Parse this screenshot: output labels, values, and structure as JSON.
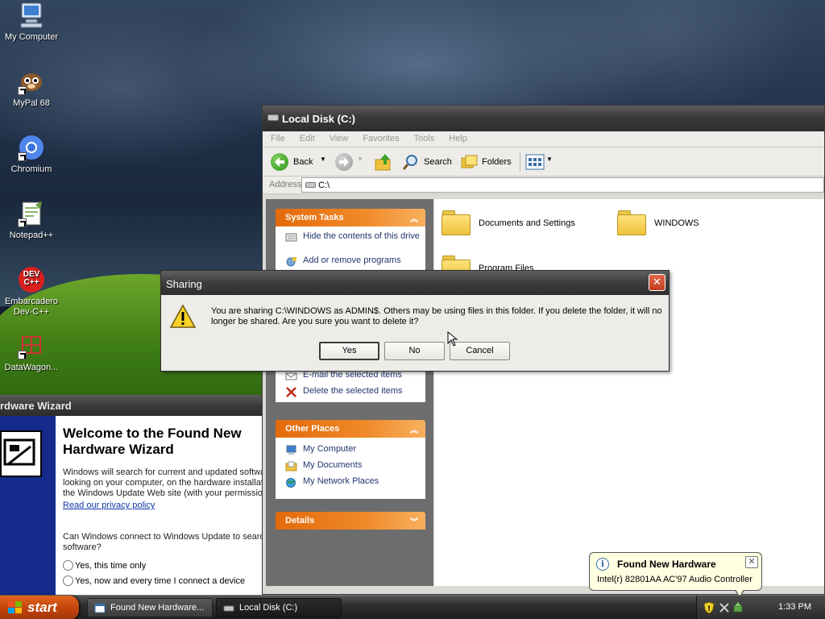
{
  "desktop": {
    "icons": [
      {
        "label": "My Computer"
      },
      {
        "label": "MyPal 68"
      },
      {
        "label": "Chromium"
      },
      {
        "label": "Notepad++"
      },
      {
        "label": "Embarcadero Dev-C++"
      },
      {
        "label": "DataWagon..."
      }
    ],
    "devcpp_logo_text": "DEV C++"
  },
  "explorer": {
    "title": "Local Disk (C:)",
    "menu": [
      "File",
      "Edit",
      "View",
      "Favorites",
      "Tools",
      "Help"
    ],
    "toolbar": {
      "back": "Back",
      "search": "Search",
      "folders": "Folders"
    },
    "address_label": "Address",
    "address_value": "C:\\",
    "system_tasks": {
      "title": "System Tasks",
      "items": [
        "Hide the contents of this drive",
        "Add or remove programs"
      ]
    },
    "file_tasks": {
      "items": [
        "E-mail the selected items",
        "Delete the selected items"
      ]
    },
    "other_places": {
      "title": "Other Places",
      "items": [
        "My Computer",
        "My Documents",
        "My Network Places"
      ]
    },
    "details": {
      "title": "Details"
    },
    "folders": [
      "Documents and Settings",
      "WINDOWS",
      "Program Files"
    ]
  },
  "wizard": {
    "title": "rdware Wizard",
    "heading": "Welcome to the Found New Hardware Wizard",
    "para1": "Windows will search for current and updated softwar looking on your computer, on the hardware installatio the Windows Update Web site (with your permission",
    "privacy_link": "Read our privacy policy",
    "question": "Can Windows connect to Windows Update to searc software?",
    "options": [
      "Yes, this time only",
      "Yes, now and every time I connect a device"
    ]
  },
  "dialog": {
    "title": "Sharing",
    "message": "You are sharing C:\\WINDOWS as ADMIN$. Others may be using files in this folder. If you delete the folder, it will no longer be shared. Are you sure you want to delete it?",
    "buttons": {
      "yes": "Yes",
      "no": "No",
      "cancel": "Cancel"
    }
  },
  "balloon": {
    "title": "Found New Hardware",
    "text": "Intel(r) 82801AA AC'97 Audio Controller"
  },
  "taskbar": {
    "start": "start",
    "tasks": [
      "Found New Hardware...",
      "Local Disk (C:)"
    ],
    "clock": "1:33 PM"
  },
  "colors": {
    "panel_header": "#e46a0b",
    "link_text": "#23366e",
    "start_button": "#c0430c",
    "balloon_bg": "#ffffe1"
  }
}
